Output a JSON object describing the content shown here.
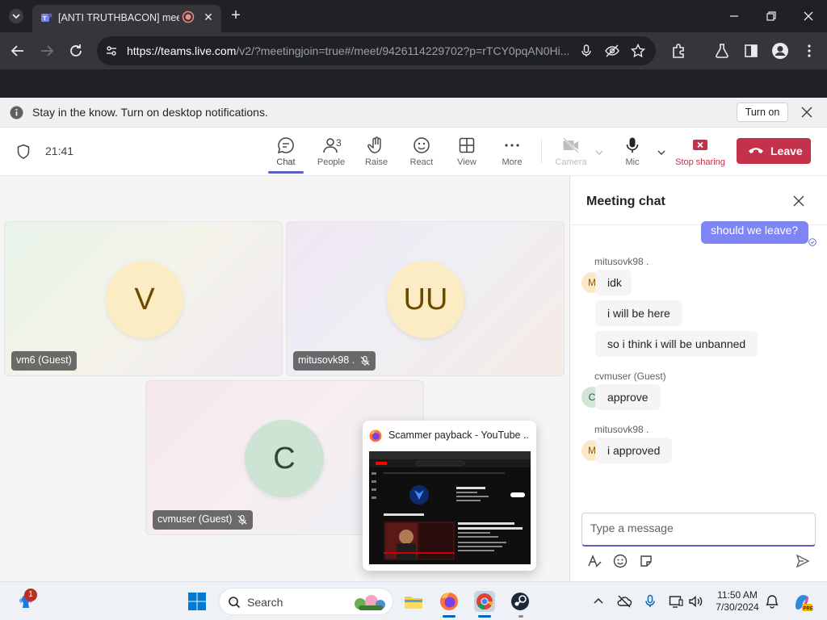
{
  "browser": {
    "tab_title": "[ANTI TRUTHBACON] meeting",
    "url_host": "https://teams.live.com",
    "url_rest": "/v2/?meetingjoin=true#/meet/9426114229702?p=rTCY0pqAN0Hi..."
  },
  "notification": {
    "text": "Stay in the know. Turn on desktop notifications.",
    "button": "Turn on"
  },
  "meeting_bar": {
    "timer": "21:41",
    "buttons": {
      "chat": "Chat",
      "people": "People",
      "people_count": "3",
      "raise": "Raise",
      "react": "React",
      "view": "View",
      "more": "More",
      "camera": "Camera",
      "mic": "Mic",
      "stop_sharing": "Stop sharing",
      "leave": "Leave"
    }
  },
  "participants": [
    {
      "initials": "V",
      "name": "vm6 (Guest)"
    },
    {
      "initials": "UU",
      "name": "mitusovk98 ."
    },
    {
      "initials": "C",
      "name": "cvmuser (Guest)"
    }
  ],
  "share_preview": {
    "title": "Scammer payback - YouTube ..."
  },
  "chat": {
    "title": "Meeting chat",
    "my_message": "should we leave?",
    "groups": [
      {
        "sender": "mitusovk98 .",
        "initial": "M",
        "messages": [
          "idk",
          "i will be here",
          "so i think i will be unbanned"
        ]
      },
      {
        "sender": "cvmuser (Guest)",
        "initial": "C",
        "messages": [
          "approve"
        ]
      },
      {
        "sender": "mitusovk98 .",
        "initial": "M",
        "messages": [
          "i approved"
        ]
      }
    ],
    "composer_placeholder": "Type a message"
  },
  "taskbar": {
    "search_label": "Search",
    "notification_badge": "1",
    "time": "11:50 AM",
    "date": "7/30/2024"
  },
  "colors": {
    "accent": "#5b5fc7",
    "leave": "#c4314b",
    "bubble_self": "#7f85f5"
  }
}
